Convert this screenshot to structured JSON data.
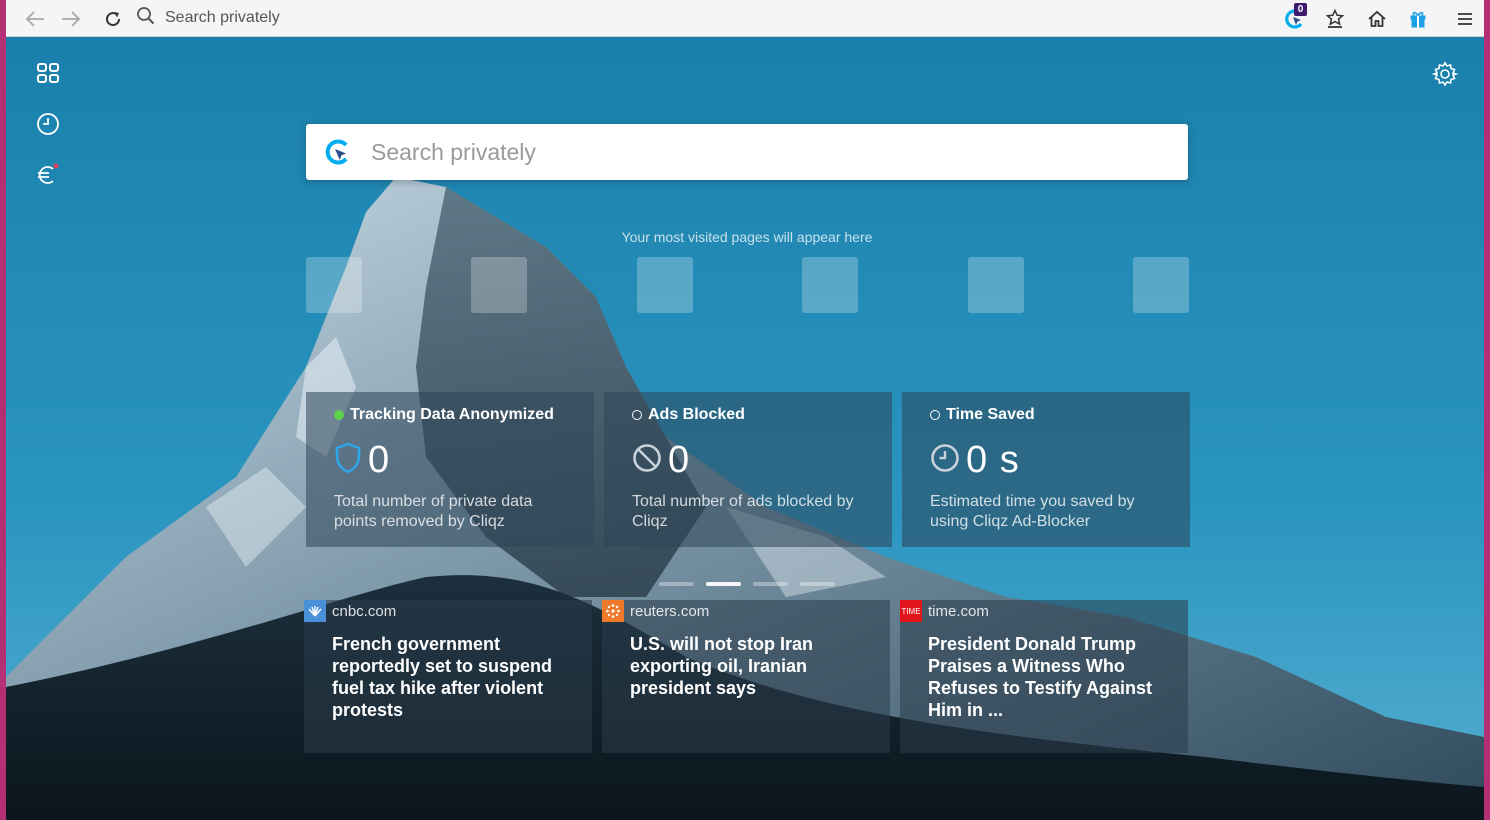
{
  "toolbar": {
    "url_placeholder": "Search privately",
    "cliqz_badge": "0",
    "icons": [
      "back-icon",
      "forward-icon",
      "reload-icon",
      "search-icon",
      "cliqz-icon",
      "bookmarks-icon",
      "home-icon",
      "gift-icon",
      "menu-icon"
    ]
  },
  "sidebar": {
    "icons": [
      "speed-dial-icon",
      "history-icon",
      "euro-icon"
    ]
  },
  "search": {
    "placeholder": "Search privately"
  },
  "most_visited": {
    "caption": "Your most visited pages will appear here",
    "tiles": [
      "",
      "",
      "",
      "",
      "",
      ""
    ]
  },
  "stats": [
    {
      "title": "Tracking Data Anonymized",
      "status": "active",
      "value": "0",
      "description": "Total number of private data points removed by Cliqz",
      "icon": "shield-icon"
    },
    {
      "title": "Ads Blocked",
      "status": "inactive",
      "value": "0",
      "description": "Total number of ads blocked by Cliqz",
      "icon": "block-icon"
    },
    {
      "title": "Time Saved",
      "status": "inactive",
      "value": "0 s",
      "description": "Estimated time you saved by using Cliqz Ad-Blocker",
      "icon": "clock-icon"
    }
  ],
  "pager": {
    "pages": 4,
    "active_index": 1
  },
  "news": [
    {
      "domain": "cnbc.com",
      "headline": "French government reportedly set to suspend fuel tax hike after violent protests",
      "favicon_color": "#4a90d9"
    },
    {
      "domain": "reuters.com",
      "headline": "U.S. will not stop Iran exporting oil, Iranian president says",
      "favicon_color": "#f07a2a"
    },
    {
      "domain": "time.com",
      "headline": "President Donald Trump Praises a Witness Who Refuses to Testify Against Him in ...",
      "favicon_color": "#e1141c",
      "favicon_text": "TIME"
    }
  ],
  "colors": {
    "frame": "#b52f74",
    "cliqz_blue": "#00aef0",
    "active_dot": "#5fd14a"
  }
}
